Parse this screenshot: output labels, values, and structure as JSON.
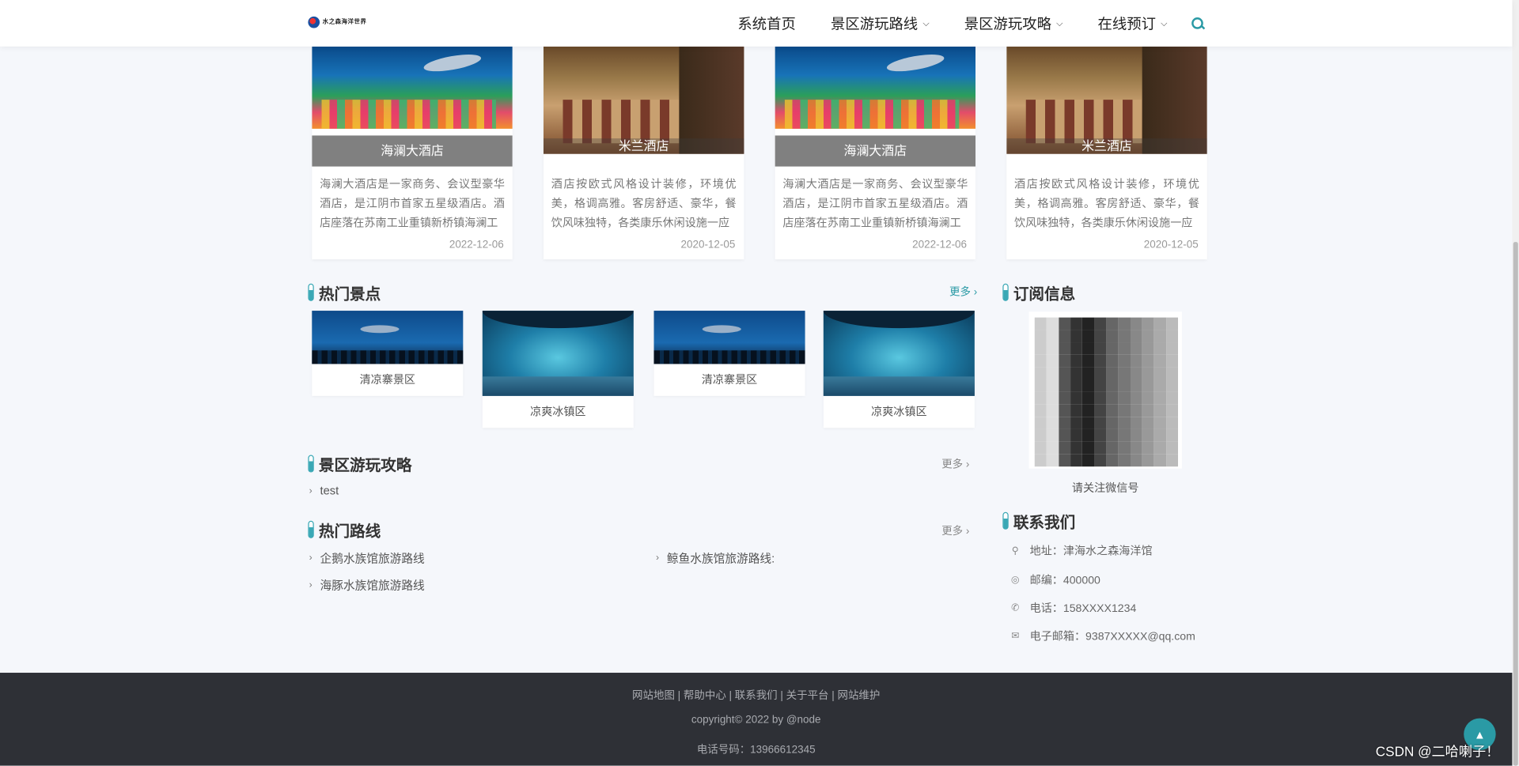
{
  "nav": {
    "logo_text": "水之森海洋世界",
    "items": [
      {
        "label": "系统首页",
        "has_dropdown": false
      },
      {
        "label": "景区游玩路线",
        "has_dropdown": true
      },
      {
        "label": "景区游玩攻略",
        "has_dropdown": true
      },
      {
        "label": "在线预订",
        "has_dropdown": true
      }
    ]
  },
  "hotels": [
    {
      "title": "海澜大酒店",
      "desc": "海澜大酒店是一家商务、会议型豪华酒店，是江阴市首家五星级酒店。酒店座落在苏南工业重镇新桥镇海澜工",
      "date": "2022-12-06",
      "image": "aquarium"
    },
    {
      "title": "米兰酒店",
      "desc": "酒店按欧式风格设计装修，环境优美，格调高雅。客房舒适、豪华，餐饮风味独特，各类康乐休闲设施一应",
      "date": "2020-12-05",
      "image": "room"
    },
    {
      "title": "海澜大酒店",
      "desc": "海澜大酒店是一家商务、会议型豪华酒店，是江阴市首家五星级酒店。酒店座落在苏南工业重镇新桥镇海澜工",
      "date": "2022-12-06",
      "image": "aquarium"
    },
    {
      "title": "米兰酒店",
      "desc": "酒店按欧式风格设计装修，环境优美，格调高雅。客房舒适、豪华，餐饮风味独特，各类康乐休闲设施一应",
      "date": "2020-12-05",
      "image": "room"
    }
  ],
  "hot_spots": {
    "title": "热门景点",
    "more": "更多 ›",
    "items": [
      {
        "label": "清凉寨景区",
        "image": "shark"
      },
      {
        "label": "凉爽冰镇区",
        "image": "tunnel"
      },
      {
        "label": "清凉寨景区",
        "image": "shark"
      },
      {
        "label": "凉爽冰镇区",
        "image": "tunnel"
      }
    ]
  },
  "guides": {
    "title": "景区游玩攻略",
    "more": "更多 ›",
    "items": [
      "test"
    ]
  },
  "routes": {
    "title": "热门路线",
    "more": "更多 ›",
    "items": [
      "企鹅水族馆旅游路线",
      "鲸鱼水族馆旅游路线:",
      "海豚水族馆旅游路线"
    ]
  },
  "subscribe": {
    "title": "订阅信息",
    "caption": "请关注微信号"
  },
  "contact": {
    "title": "联系我们",
    "items": [
      {
        "icon": "location-icon",
        "text": "地址：津海水之森海洋馆"
      },
      {
        "icon": "postcode-icon",
        "text": "邮编：400000"
      },
      {
        "icon": "phone-icon",
        "text": "电话：158XXXX1234"
      },
      {
        "icon": "mail-icon",
        "text": "电子邮箱：9387XXXXX@qq.com"
      }
    ]
  },
  "footer": {
    "links": "网站地图 | 帮助中心 | 联系我们 | 关于平台 | 网站维护",
    "copyright": "copyright© 2022 by @node",
    "phone": "电话号码：13966612345"
  },
  "watermark": "CSDN @二哈喇子！",
  "colors": {
    "accent": "#2a9aa5",
    "footer_bg": "#2e3036"
  }
}
